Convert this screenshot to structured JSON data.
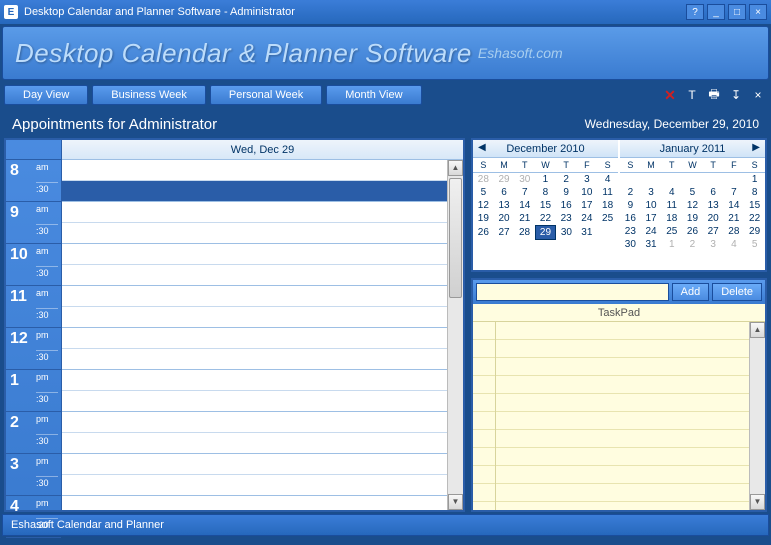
{
  "window": {
    "icon_letter": "E",
    "title": "Desktop Calendar and Planner Software - Administrator"
  },
  "header": {
    "title": "Desktop Calendar & Planner Software",
    "subtitle": "Eshasoft.com"
  },
  "tabs": [
    {
      "label": "Day View"
    },
    {
      "label": "Business Week"
    },
    {
      "label": "Personal Week"
    },
    {
      "label": "Month View"
    }
  ],
  "context": {
    "title": "Appointments for Administrator",
    "date": "Wednesday, December 29, 2010"
  },
  "day": {
    "header": "Wed, Dec 29",
    "hours": [
      {
        "h": "8",
        "ap": "am",
        "half": ":30"
      },
      {
        "h": "9",
        "ap": "am",
        "half": ":30"
      },
      {
        "h": "10",
        "ap": "am",
        "half": ":30"
      },
      {
        "h": "11",
        "ap": "am",
        "half": ":30"
      },
      {
        "h": "12",
        "ap": "pm",
        "half": ":30"
      },
      {
        "h": "1",
        "ap": "pm",
        "half": ":30"
      },
      {
        "h": "2",
        "ap": "pm",
        "half": ":30"
      },
      {
        "h": "3",
        "ap": "pm",
        "half": ":30"
      },
      {
        "h": "4",
        "ap": "pm",
        "half": ":30"
      }
    ],
    "selected_slot_index": 1
  },
  "minicals": [
    {
      "title": "December 2010",
      "dow": [
        "S",
        "M",
        "T",
        "W",
        "T",
        "F",
        "S"
      ],
      "weeks": [
        [
          {
            "d": "28",
            "o": true
          },
          {
            "d": "29",
            "o": true
          },
          {
            "d": "30",
            "o": true
          },
          {
            "d": "1"
          },
          {
            "d": "2"
          },
          {
            "d": "3"
          },
          {
            "d": "4"
          }
        ],
        [
          {
            "d": "5"
          },
          {
            "d": "6"
          },
          {
            "d": "7"
          },
          {
            "d": "8"
          },
          {
            "d": "9"
          },
          {
            "d": "10"
          },
          {
            "d": "11"
          }
        ],
        [
          {
            "d": "12"
          },
          {
            "d": "13"
          },
          {
            "d": "14"
          },
          {
            "d": "15"
          },
          {
            "d": "16"
          },
          {
            "d": "17"
          },
          {
            "d": "18"
          }
        ],
        [
          {
            "d": "19"
          },
          {
            "d": "20"
          },
          {
            "d": "21"
          },
          {
            "d": "22"
          },
          {
            "d": "23"
          },
          {
            "d": "24"
          },
          {
            "d": "25"
          }
        ],
        [
          {
            "d": "26"
          },
          {
            "d": "27"
          },
          {
            "d": "28"
          },
          {
            "d": "29",
            "t": true
          },
          {
            "d": "30"
          },
          {
            "d": "31"
          },
          {
            "d": ""
          }
        ]
      ]
    },
    {
      "title": "January 2011",
      "dow": [
        "S",
        "M",
        "T",
        "W",
        "T",
        "F",
        "S"
      ],
      "weeks": [
        [
          {
            "d": ""
          },
          {
            "d": ""
          },
          {
            "d": ""
          },
          {
            "d": ""
          },
          {
            "d": ""
          },
          {
            "d": ""
          },
          {
            "d": "1"
          }
        ],
        [
          {
            "d": "2"
          },
          {
            "d": "3"
          },
          {
            "d": "4"
          },
          {
            "d": "5"
          },
          {
            "d": "6"
          },
          {
            "d": "7"
          },
          {
            "d": "8"
          }
        ],
        [
          {
            "d": "9"
          },
          {
            "d": "10"
          },
          {
            "d": "11"
          },
          {
            "d": "12"
          },
          {
            "d": "13"
          },
          {
            "d": "14"
          },
          {
            "d": "15"
          }
        ],
        [
          {
            "d": "16"
          },
          {
            "d": "17"
          },
          {
            "d": "18"
          },
          {
            "d": "19"
          },
          {
            "d": "20"
          },
          {
            "d": "21"
          },
          {
            "d": "22"
          }
        ],
        [
          {
            "d": "23"
          },
          {
            "d": "24"
          },
          {
            "d": "25"
          },
          {
            "d": "26"
          },
          {
            "d": "27"
          },
          {
            "d": "28"
          },
          {
            "d": "29"
          }
        ],
        [
          {
            "d": "30"
          },
          {
            "d": "31"
          },
          {
            "d": "1",
            "o": true
          },
          {
            "d": "2",
            "o": true
          },
          {
            "d": "3",
            "o": true
          },
          {
            "d": "4",
            "o": true
          },
          {
            "d": "5",
            "o": true
          }
        ]
      ]
    }
  ],
  "taskpad": {
    "add_label": "Add",
    "delete_label": "Delete",
    "header": "TaskPad",
    "input_value": ""
  },
  "status": {
    "text": "Eshasoft Calendar and Planner"
  },
  "glyphs": {
    "help": "?",
    "min": "_",
    "max": "□",
    "close": "×",
    "left": "◀",
    "right": "▶",
    "up": "▲",
    "down": "▼",
    "delete_x": "✕",
    "text_t": "T",
    "print": "🖶",
    "sort": "↧"
  }
}
